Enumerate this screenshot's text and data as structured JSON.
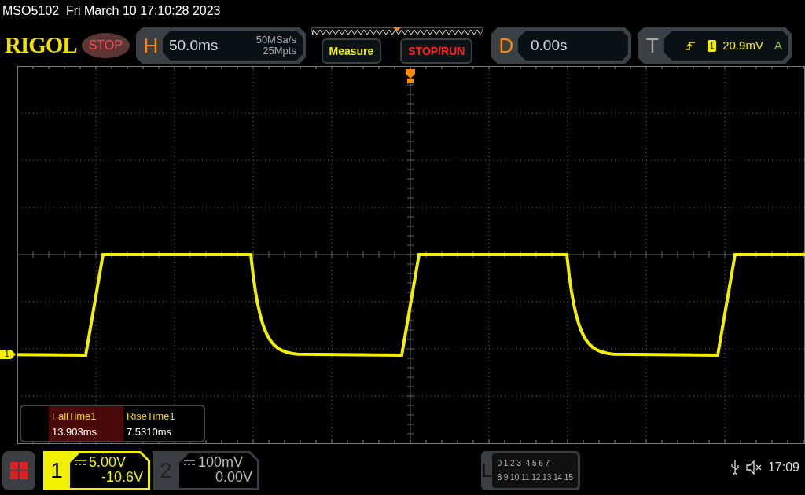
{
  "status_line": "MSO5102  Fri March 10 17:10:28 2023",
  "logo": "RIGOL",
  "run_state": {
    "label": "STOP"
  },
  "horizontal": {
    "letter": "H",
    "timebase": "50.0ms",
    "sample_rate": "50MSa/s",
    "memory_depth": "25Mpts"
  },
  "buttons": [
    {
      "label": "Measure",
      "kind": "measure"
    },
    {
      "label": "STOP/RUN",
      "kind": "stoprun"
    }
  ],
  "delay": {
    "letter": "D",
    "value": "0.00s"
  },
  "trigger": {
    "letter": "T",
    "source": "1",
    "level": "20.9mV",
    "mode": "A"
  },
  "channel_marker": "1",
  "measurements": [
    {
      "name": "FallTime1",
      "value": "13.903ms",
      "selected": true
    },
    {
      "name": "RiseTime1",
      "value": "7.5310ms",
      "selected": false
    }
  ],
  "channels": [
    {
      "number": "1",
      "scale": "5.00V",
      "offset": "-10.6V",
      "active": true
    },
    {
      "number": "2",
      "scale": "100mV",
      "offset": "0.00V",
      "active": false
    }
  ],
  "logic": {
    "letter": "L",
    "rows": [
      "0 1 2 3  4 5 6 7",
      "8 9 10 11 12 13 14 15"
    ]
  },
  "clock": "17:09"
}
